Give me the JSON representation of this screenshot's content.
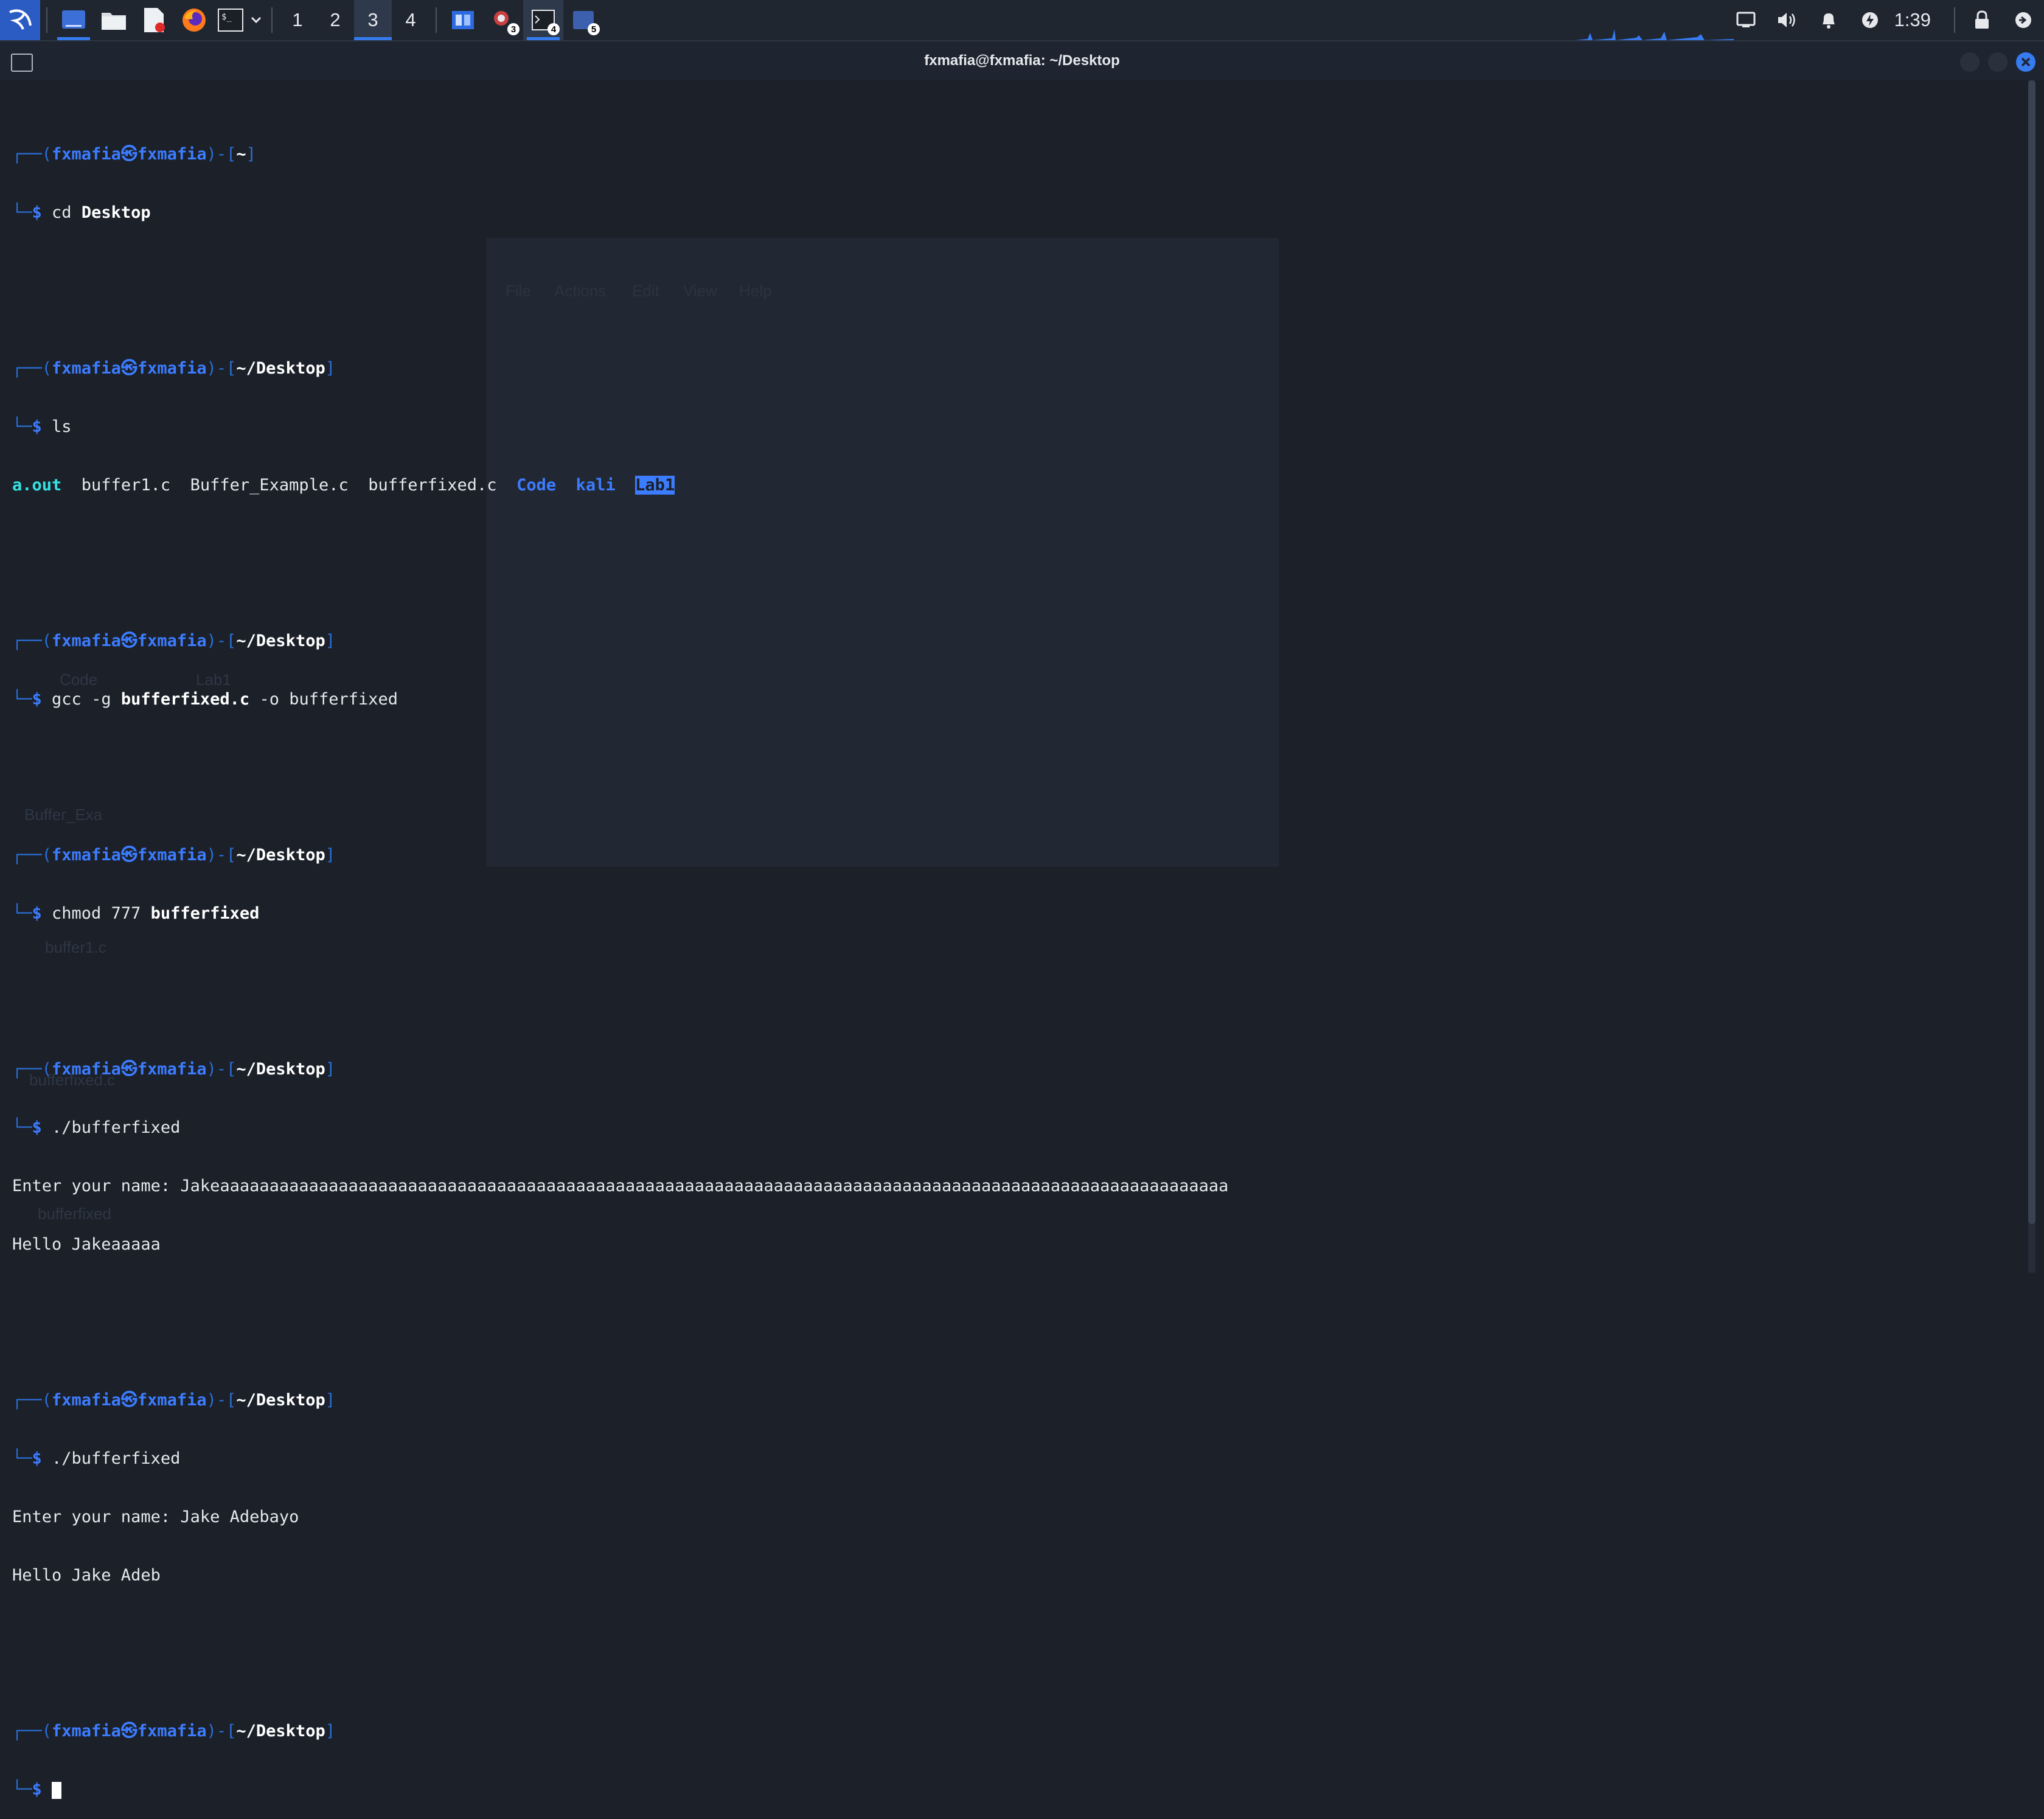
{
  "taskbar": {
    "workspaces": [
      "1",
      "2",
      "3",
      "4"
    ],
    "active_workspace": "3",
    "task_badges": [
      "3",
      "4",
      "5"
    ],
    "clock": "1:39"
  },
  "window": {
    "title": "fxmafia@fxmafia: ~/Desktop"
  },
  "background_window": {
    "menu": [
      "File",
      "Actions",
      "Edit",
      "View",
      "Help"
    ]
  },
  "desktop_icons": [
    "Code",
    "Lab1",
    "Buffer_Exa",
    "buffer1.c",
    "bufferfixed.c",
    "bufferfixed"
  ],
  "terminal": {
    "user": "fxmafia",
    "host": "fxmafia",
    "home_path": "~",
    "desktop_path": "~/Desktop",
    "cmd1_name": "cd",
    "cmd1_arg": "Desktop",
    "cmd2": "ls",
    "ls_output": {
      "exec": "a.out",
      "files": [
        "buffer1.c",
        "Buffer_Example.c",
        "bufferfixed.c"
      ],
      "dirs": [
        "Code",
        "kali"
      ],
      "highlighted_dir": "Lab1"
    },
    "cmd3_name": "gcc",
    "cmd3_flag": "-g",
    "cmd3_file": "bufferfixed.c",
    "cmd3_rest": "-o bufferfixed",
    "cmd4_name": "chmod",
    "cmd4_mode": "777",
    "cmd4_file": "bufferfixed",
    "cmd5": "./bufferfixed",
    "run1_prompt": "Enter your name: Jakeaaaaaaaaaaaaaaaaaaaaaaaaaaaaaaaaaaaaaaaaaaaaaaaaaaaaaaaaaaaaaaaaaaaaaaaaaaaaaaaaaaaaaaaaaaaaaaaaaaaaaa",
    "run1_output": "Hello Jakeaaaaa",
    "cmd6": "./bufferfixed",
    "run2_prompt": "Enter your name: Jake Adebayo",
    "run2_output": "Hello Jake Adeb"
  }
}
